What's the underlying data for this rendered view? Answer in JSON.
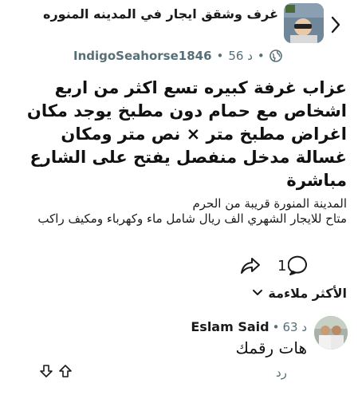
{
  "header": {
    "group_title": "غرف وشقق ايجار في المدينه المنوره",
    "username": "IndigoSeahorse1846",
    "time": "56 د"
  },
  "post": {
    "body": "عزاب غرفة كبيره تسع اكثر من اربع اشخاص مع حمام دون مطبخ يوجد مكان اغراض مطبخ متر × نص متر ومكان غسالة مدخل منفصل يفتح على الشارع مباشرة",
    "subtitle": "المدينة المنورة قريبة من الحرم",
    "details": "متاح للايجار الشهري  الف ريال شامل ماء وكهرباء ومكيف راكب"
  },
  "actions": {
    "comment_count": "1"
  },
  "sort": {
    "label": "الأكثر ملاءمة"
  },
  "comment": {
    "author": "Eslam Said",
    "time": "63 د",
    "text": "هات رقمك",
    "reply_label": "رد"
  },
  "colors": {
    "text": "#1a1a1b",
    "meta": "#576f76"
  }
}
